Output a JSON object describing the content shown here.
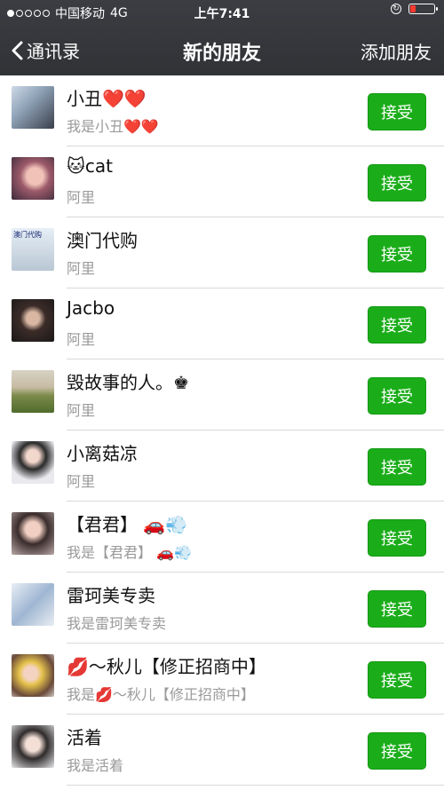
{
  "status_bar": {
    "carrier": "中国移动",
    "network": "4G",
    "time": "上午7:41",
    "signal_strength": 1,
    "battery_level": 0.2,
    "battery_color": "#ff3b30"
  },
  "nav": {
    "back_label": "通讯录",
    "title": "新的朋友",
    "action_label": "添加朋友"
  },
  "colors": {
    "accent": "#1aad19",
    "header_bg": "#36383c"
  },
  "requests": [
    {
      "name": "小丑❤️❤️",
      "message": "我是小丑❤️❤️",
      "button": "接受",
      "avatar_style": "background: linear-gradient(135deg,#cfd9e6 0%,#8fa3b8 40%,#3a3f4a 100%);"
    },
    {
      "name": "🐱cat",
      "message": "阿里",
      "button": "接受",
      "avatar_style": "background: radial-gradient(circle at 55% 45%, #f0c2b8 0 25%, #9c5a6a 45%, #3b2a3a 100%);"
    },
    {
      "name": "澳门代购",
      "message": "阿里",
      "button": "接受",
      "avatar_style": "background: linear-gradient(#e6eef6,#b9c7d4);",
      "avatar_text": "澳门代购"
    },
    {
      "name": "Jacbo",
      "message": "阿里",
      "button": "接受",
      "avatar_style": "background: radial-gradient(circle at 50% 45%, #d9b7a3 0 20%, #3b2c28 40%, #1a1818 100%);"
    },
    {
      "name": "毁故事的人。♚",
      "message": "阿里",
      "button": "接受",
      "avatar_style": "background: linear-gradient(#d7d2c4 0%, #c7bca3 40%, #7c8a4a 60%, #4f6b2c 100%);"
    },
    {
      "name": "小离菇凉",
      "message": "阿里",
      "button": "接受",
      "avatar_style": "background: radial-gradient(circle at 50% 35%, #f2d7cc 0 18%, #2a2a2a 38%, #e9e9ee 70%);"
    },
    {
      "name": "【君君】 🚗💨",
      "message": "我是【君君】 🚗💨",
      "button": "接受",
      "avatar_style": "background: radial-gradient(circle at 50% 40%, #f1cfc2 0 22%, #3a2c2c 45%, #b9a7a7 100%);"
    },
    {
      "name": "雷珂美专卖",
      "message": "我是雷珂美专卖",
      "button": "接受",
      "avatar_style": "background: linear-gradient(135deg,#e8eef6 0%,#9fb6d2 50%,#e9edf3 100%);"
    },
    {
      "name": "💋～秋儿【修正招商中】",
      "message": "我是💋～秋儿【修正招商中】",
      "button": "接受",
      "avatar_style": "background: radial-gradient(circle at 45% 45%, #f5d3c2 0 20%, #e5c24b 35%, #6a4a3a 70%, #cfc6c0 100%);"
    },
    {
      "name": "活着",
      "message": "我是活着",
      "button": "接受",
      "avatar_style": "background: radial-gradient(circle at 50% 45%, #f3dfd6 0 22%, #2f2b2b 45%, #e7e7ea 100%);"
    }
  ]
}
